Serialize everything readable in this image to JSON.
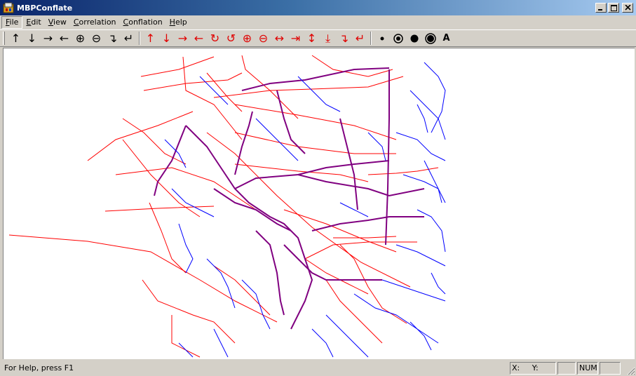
{
  "window": {
    "title": "MBPConflate"
  },
  "menu": [
    {
      "label": "File",
      "underline": "F",
      "rest": "ile"
    },
    {
      "label": "Edit",
      "underline": "E",
      "rest": "dit"
    },
    {
      "label": "View",
      "underline": "V",
      "rest": "iew"
    },
    {
      "label": "Correlation",
      "underline": "C",
      "rest": "orrelation"
    },
    {
      "label": "Conflation",
      "underline": "C",
      "rest": "onflation"
    },
    {
      "label": "Help",
      "underline": "H",
      "rest": "elp"
    }
  ],
  "toolbar": {
    "black_group": [
      {
        "name": "pan-up-icon",
        "glyph": "↑"
      },
      {
        "name": "pan-down-icon",
        "glyph": "↓"
      },
      {
        "name": "pan-right-icon",
        "glyph": "→"
      },
      {
        "name": "pan-left-icon",
        "glyph": "←"
      },
      {
        "name": "zoom-in-icon",
        "glyph": "⊕"
      },
      {
        "name": "zoom-out-icon",
        "glyph": "⊖"
      },
      {
        "name": "turn-right-icon",
        "glyph": "↴"
      },
      {
        "name": "turn-left-icon",
        "glyph": "↵"
      }
    ],
    "red_group": [
      {
        "name": "layer-up-icon",
        "glyph": "↑"
      },
      {
        "name": "layer-down-icon",
        "glyph": "↓"
      },
      {
        "name": "layer-right-icon",
        "glyph": "→"
      },
      {
        "name": "layer-left-icon",
        "glyph": "←"
      },
      {
        "name": "rotate-cw-icon",
        "glyph": "↻"
      },
      {
        "name": "rotate-ccw-icon",
        "glyph": "↺"
      },
      {
        "name": "layer-zoom-in-icon",
        "glyph": "⊕"
      },
      {
        "name": "layer-zoom-out-icon",
        "glyph": "⊖"
      },
      {
        "name": "stretch-horizontal-icon",
        "glyph": "↔"
      },
      {
        "name": "shrink-horizontal-icon",
        "glyph": "⇥"
      },
      {
        "name": "stretch-vertical-icon",
        "glyph": "↕"
      },
      {
        "name": "shrink-vertical-icon",
        "glyph": "⤓"
      },
      {
        "name": "layer-turn-right-icon",
        "glyph": "↴"
      },
      {
        "name": "layer-turn-left-icon",
        "glyph": "↵"
      }
    ],
    "point_group": [
      {
        "name": "small-point-icon"
      },
      {
        "name": "ring-point-icon"
      },
      {
        "name": "large-point-icon"
      },
      {
        "name": "double-ring-point-icon"
      }
    ],
    "text_button_label": "A"
  },
  "status": {
    "help_text": "For Help, press F1",
    "x_label": "X:",
    "y_label": "Y:",
    "num_indicator": "NUM"
  },
  "colors": {
    "title_gradient_start": "#0a246a",
    "title_gradient_end": "#a6caf0",
    "reference_layer": "#0000ff",
    "target_layer": "#ff0000",
    "conflated_overlap": "#800080"
  }
}
